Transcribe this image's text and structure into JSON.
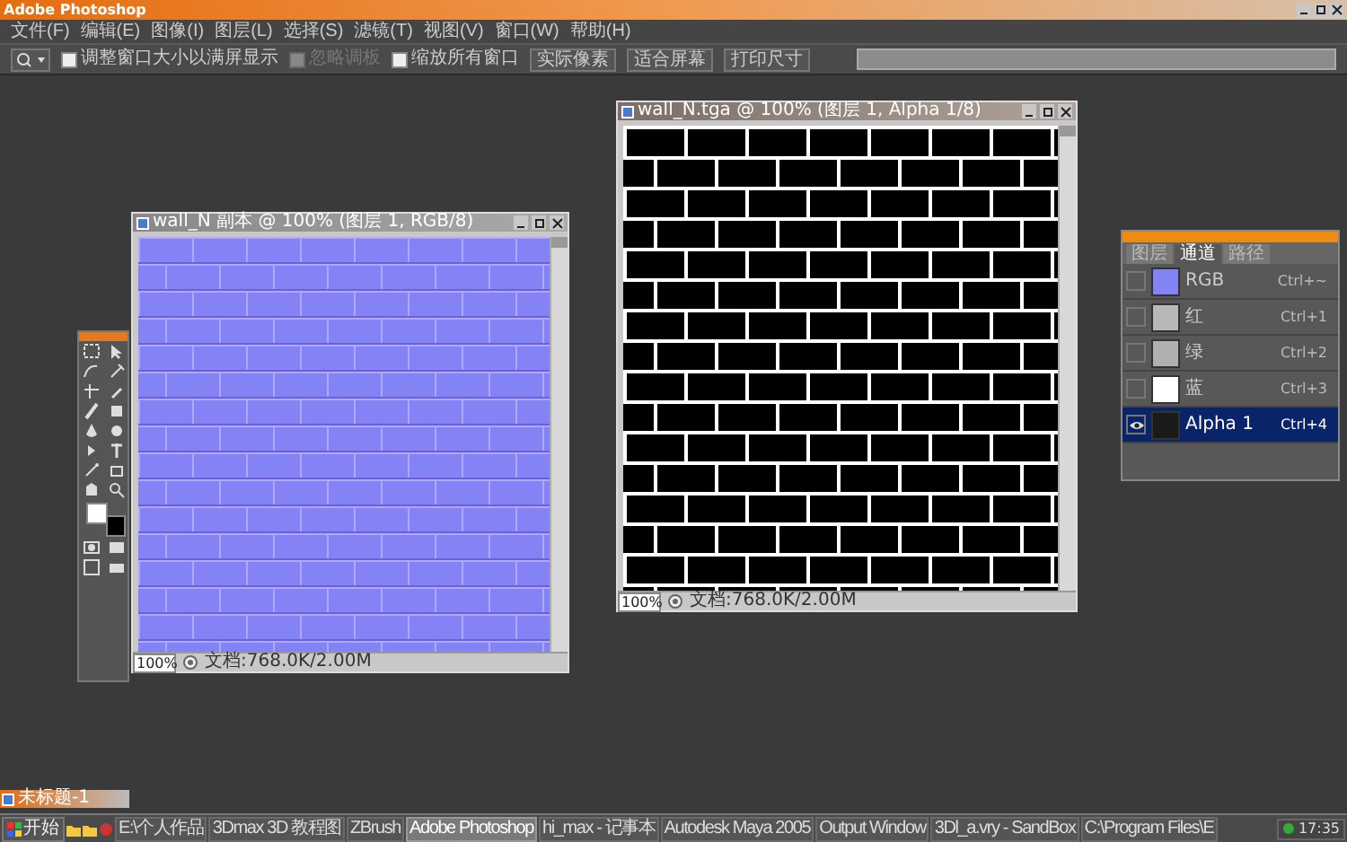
{
  "window": {
    "title": "Adobe Photoshop"
  },
  "menu": [
    "文件(F)",
    "编辑(E)",
    "图像(I)",
    "图层(L)",
    "选择(S)",
    "滤镜(T)",
    "视图(V)",
    "窗口(W)",
    "帮助(H)"
  ],
  "options_bar": {
    "checkboxes": [
      {
        "label": "调整窗口大小以满屏显示",
        "checked": false,
        "disabled": false
      },
      {
        "label": "忽略调板",
        "checked": false,
        "disabled": true
      },
      {
        "label": "缩放所有窗口",
        "checked": false,
        "disabled": false
      }
    ],
    "buttons": [
      "实际像素",
      "适合屏幕",
      "打印尺寸"
    ]
  },
  "documents": [
    {
      "title": "wall_N 副本 @ 100% (图层 1, RGB/8)",
      "kind": "normal_map",
      "zoom": "100%",
      "doc_size": "文档:768.0K/2.00M"
    },
    {
      "title": "wall_N.tga @ 100% (图层 1, Alpha 1/8)",
      "kind": "alpha",
      "zoom": "100%",
      "doc_size": "文档:768.0K/2.00M"
    }
  ],
  "channels_panel": {
    "tabs": [
      {
        "label": "图层",
        "selected": false
      },
      {
        "label": "通道",
        "selected": true
      },
      {
        "label": "路径",
        "selected": false
      }
    ],
    "channels": [
      {
        "name": "RGB",
        "shortcut": "Ctrl+~",
        "kind": "rgb",
        "visible": false,
        "selected": false
      },
      {
        "name": "红",
        "shortcut": "Ctrl+1",
        "kind": "red",
        "visible": false,
        "selected": false
      },
      {
        "name": "绿",
        "shortcut": "Ctrl+2",
        "kind": "green",
        "visible": false,
        "selected": false
      },
      {
        "name": "蓝",
        "shortcut": "Ctrl+3",
        "kind": "blue",
        "visible": false,
        "selected": false
      },
      {
        "name": "Alpha 1",
        "shortcut": "Ctrl+4",
        "kind": "alpha",
        "visible": true,
        "selected": true
      }
    ]
  },
  "minimized_window": {
    "title": "未标题-1"
  },
  "taskbar": {
    "start": "开始",
    "items": [
      {
        "label": "E:\\个人作品",
        "selected": false
      },
      {
        "label": "3Dmax 3D 教程图",
        "selected": false
      },
      {
        "label": "ZBrush",
        "selected": false
      },
      {
        "label": "Adobe Photoshop",
        "selected": true
      },
      {
        "label": "hi_max - 记事本",
        "selected": false
      },
      {
        "label": "Autodesk Maya 2005",
        "selected": false
      },
      {
        "label": "Output Window",
        "selected": false
      },
      {
        "label": "3Dl_a.vry - SandBox",
        "selected": false
      },
      {
        "label": "C:\\Program Files\\E",
        "selected": false
      }
    ],
    "clock": "17:35"
  }
}
